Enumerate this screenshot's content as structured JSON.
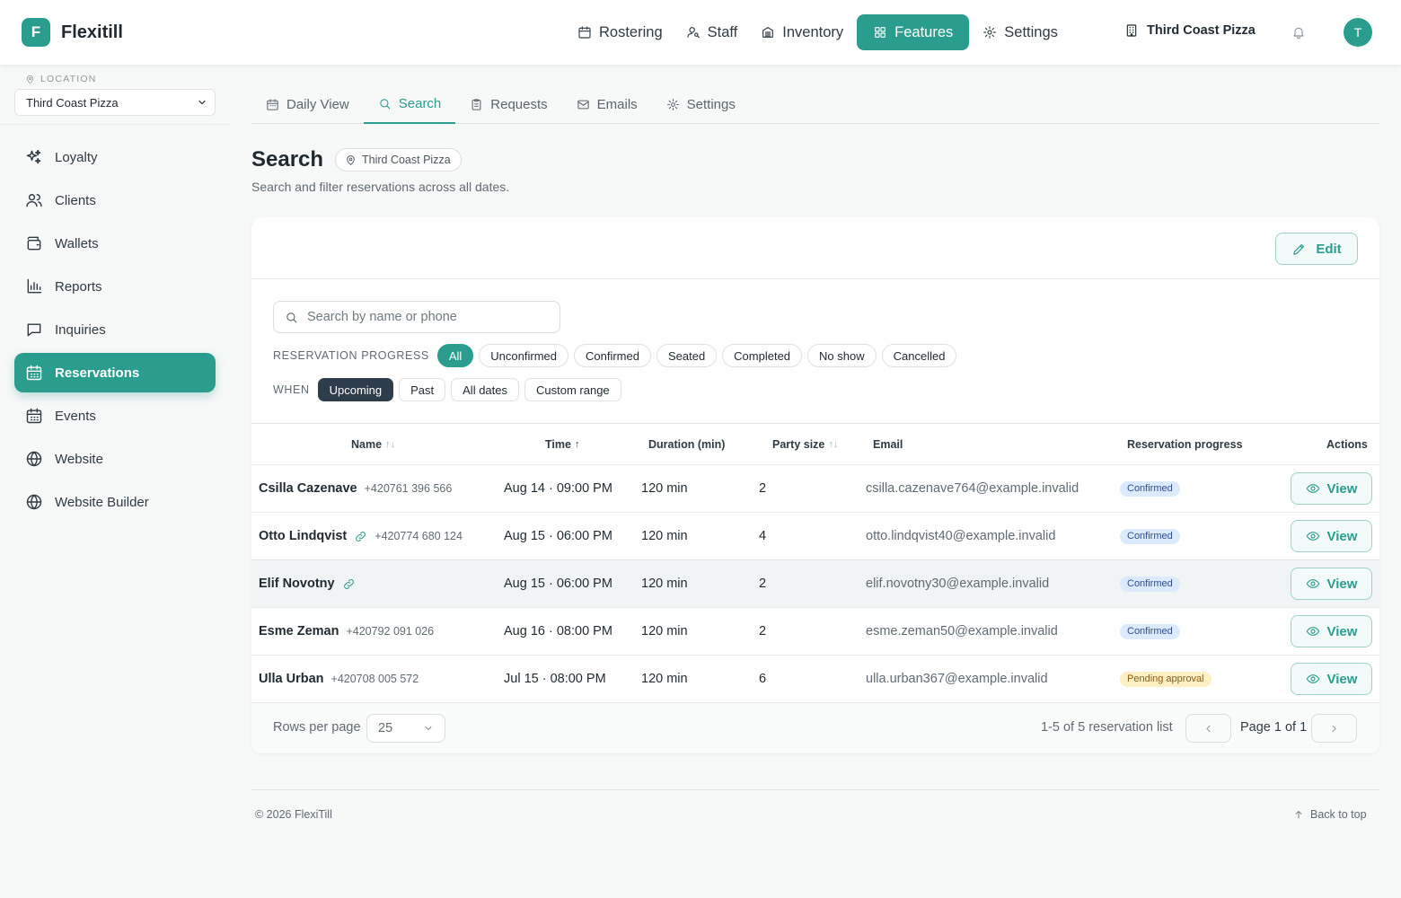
{
  "app": {
    "logo_letter": "F",
    "name": "Flexitill"
  },
  "topnav": [
    {
      "label": "Rostering",
      "icon": "calendar-icon"
    },
    {
      "label": "Staff",
      "icon": "user-key-icon"
    },
    {
      "label": "Inventory",
      "icon": "archive-icon"
    },
    {
      "label": "Features",
      "icon": "grid-icon",
      "active": true
    },
    {
      "label": "Settings",
      "icon": "gear-icon"
    }
  ],
  "top_location": "Third Coast Pizza",
  "user_initial": "T",
  "sidebar": {
    "location_label": "LOCATION",
    "location_value": "Third Coast Pizza",
    "items": [
      {
        "label": "Loyalty",
        "icon": "sparkles-icon"
      },
      {
        "label": "Clients",
        "icon": "users-icon"
      },
      {
        "label": "Wallets",
        "icon": "wallet-icon"
      },
      {
        "label": "Reports",
        "icon": "bar-chart-icon"
      },
      {
        "label": "Inquiries",
        "icon": "message-icon"
      },
      {
        "label": "Reservations",
        "icon": "calendar-grid-icon",
        "active": true
      },
      {
        "label": "Events",
        "icon": "calendar-grid-icon"
      },
      {
        "label": "Website",
        "icon": "globe-icon"
      },
      {
        "label": "Website Builder",
        "icon": "globe-icon"
      }
    ]
  },
  "tabs": [
    {
      "label": "Daily View",
      "icon": "calendar-icon"
    },
    {
      "label": "Search",
      "icon": "search-icon",
      "active": true
    },
    {
      "label": "Requests",
      "icon": "clipboard-icon"
    },
    {
      "label": "Emails",
      "icon": "mail-icon"
    },
    {
      "label": "Settings",
      "icon": "gear-icon"
    }
  ],
  "page": {
    "title": "Search",
    "location_badge": "Third Coast Pizza",
    "subtitle": "Search and filter reservations across all dates."
  },
  "card": {
    "edit_label": "Edit",
    "search_placeholder": "Search by name or phone",
    "progress_label": "RESERVATION PROGRESS",
    "progress_filters": [
      "All",
      "Unconfirmed",
      "Confirmed",
      "Seated",
      "Completed",
      "No show",
      "Cancelled"
    ],
    "progress_selected": "All",
    "when_label": "WHEN",
    "when_filters": [
      "Upcoming",
      "Past",
      "All dates",
      "Custom range"
    ],
    "when_selected": "Upcoming"
  },
  "table": {
    "columns": {
      "name": "Name",
      "time": "Time",
      "duration": "Duration (min)",
      "party": "Party size",
      "email": "Email",
      "progress": "Reservation progress",
      "actions": "Actions"
    },
    "sort_icons": {
      "name": "↑↓",
      "time": "↑",
      "party": "↑↓"
    },
    "view_label": "View",
    "rows": [
      {
        "name": "Csilla Cazenave",
        "linked": false,
        "phone": "+420761 396 566",
        "time": "Aug 14 · 09:00 PM",
        "duration": "120 min",
        "party": "2",
        "email": "csilla.cazenave764@example.invalid",
        "progress": "Confirmed",
        "progress_color": "blue"
      },
      {
        "name": "Otto Lindqvist",
        "linked": true,
        "phone": "+420774 680 124",
        "time": "Aug 15 · 06:00 PM",
        "duration": "120 min",
        "party": "4",
        "email": "otto.lindqvist40@example.invalid",
        "progress": "Confirmed",
        "progress_color": "blue"
      },
      {
        "name": "Elif Novotny",
        "linked": true,
        "phone": "",
        "time": "Aug 15 · 06:00 PM",
        "duration": "120 min",
        "party": "2",
        "email": "elif.novotny30@example.invalid",
        "progress": "Confirmed",
        "progress_color": "blue",
        "hover": true
      },
      {
        "name": "Esme Zeman",
        "linked": false,
        "phone": "+420792 091 026",
        "time": "Aug 16 · 08:00 PM",
        "duration": "120 min",
        "party": "2",
        "email": "esme.zeman50@example.invalid",
        "progress": "Confirmed",
        "progress_color": "blue"
      },
      {
        "name": "Ulla Urban",
        "linked": false,
        "phone": "+420708 005 572",
        "time": "Jul 15 · 08:00 PM",
        "duration": "120 min",
        "party": "6",
        "email": "ulla.urban367@example.invalid",
        "progress": "Pending approval",
        "progress_color": "amber"
      }
    ]
  },
  "pager": {
    "rows_label": "Rows per page",
    "rows_value": "25",
    "range_text": "1-5 of 5 reservation list",
    "page_text": "Page 1 of 1"
  },
  "footer": {
    "copyright": "© 2026 FlexiTill",
    "back_to_top": "Back to top"
  },
  "colors": {
    "accent": "#2a9d8f",
    "dark_chip": "#2e3d4c",
    "confirmed_bg": "#dbeafe",
    "pending_bg": "#fdf0c4"
  }
}
